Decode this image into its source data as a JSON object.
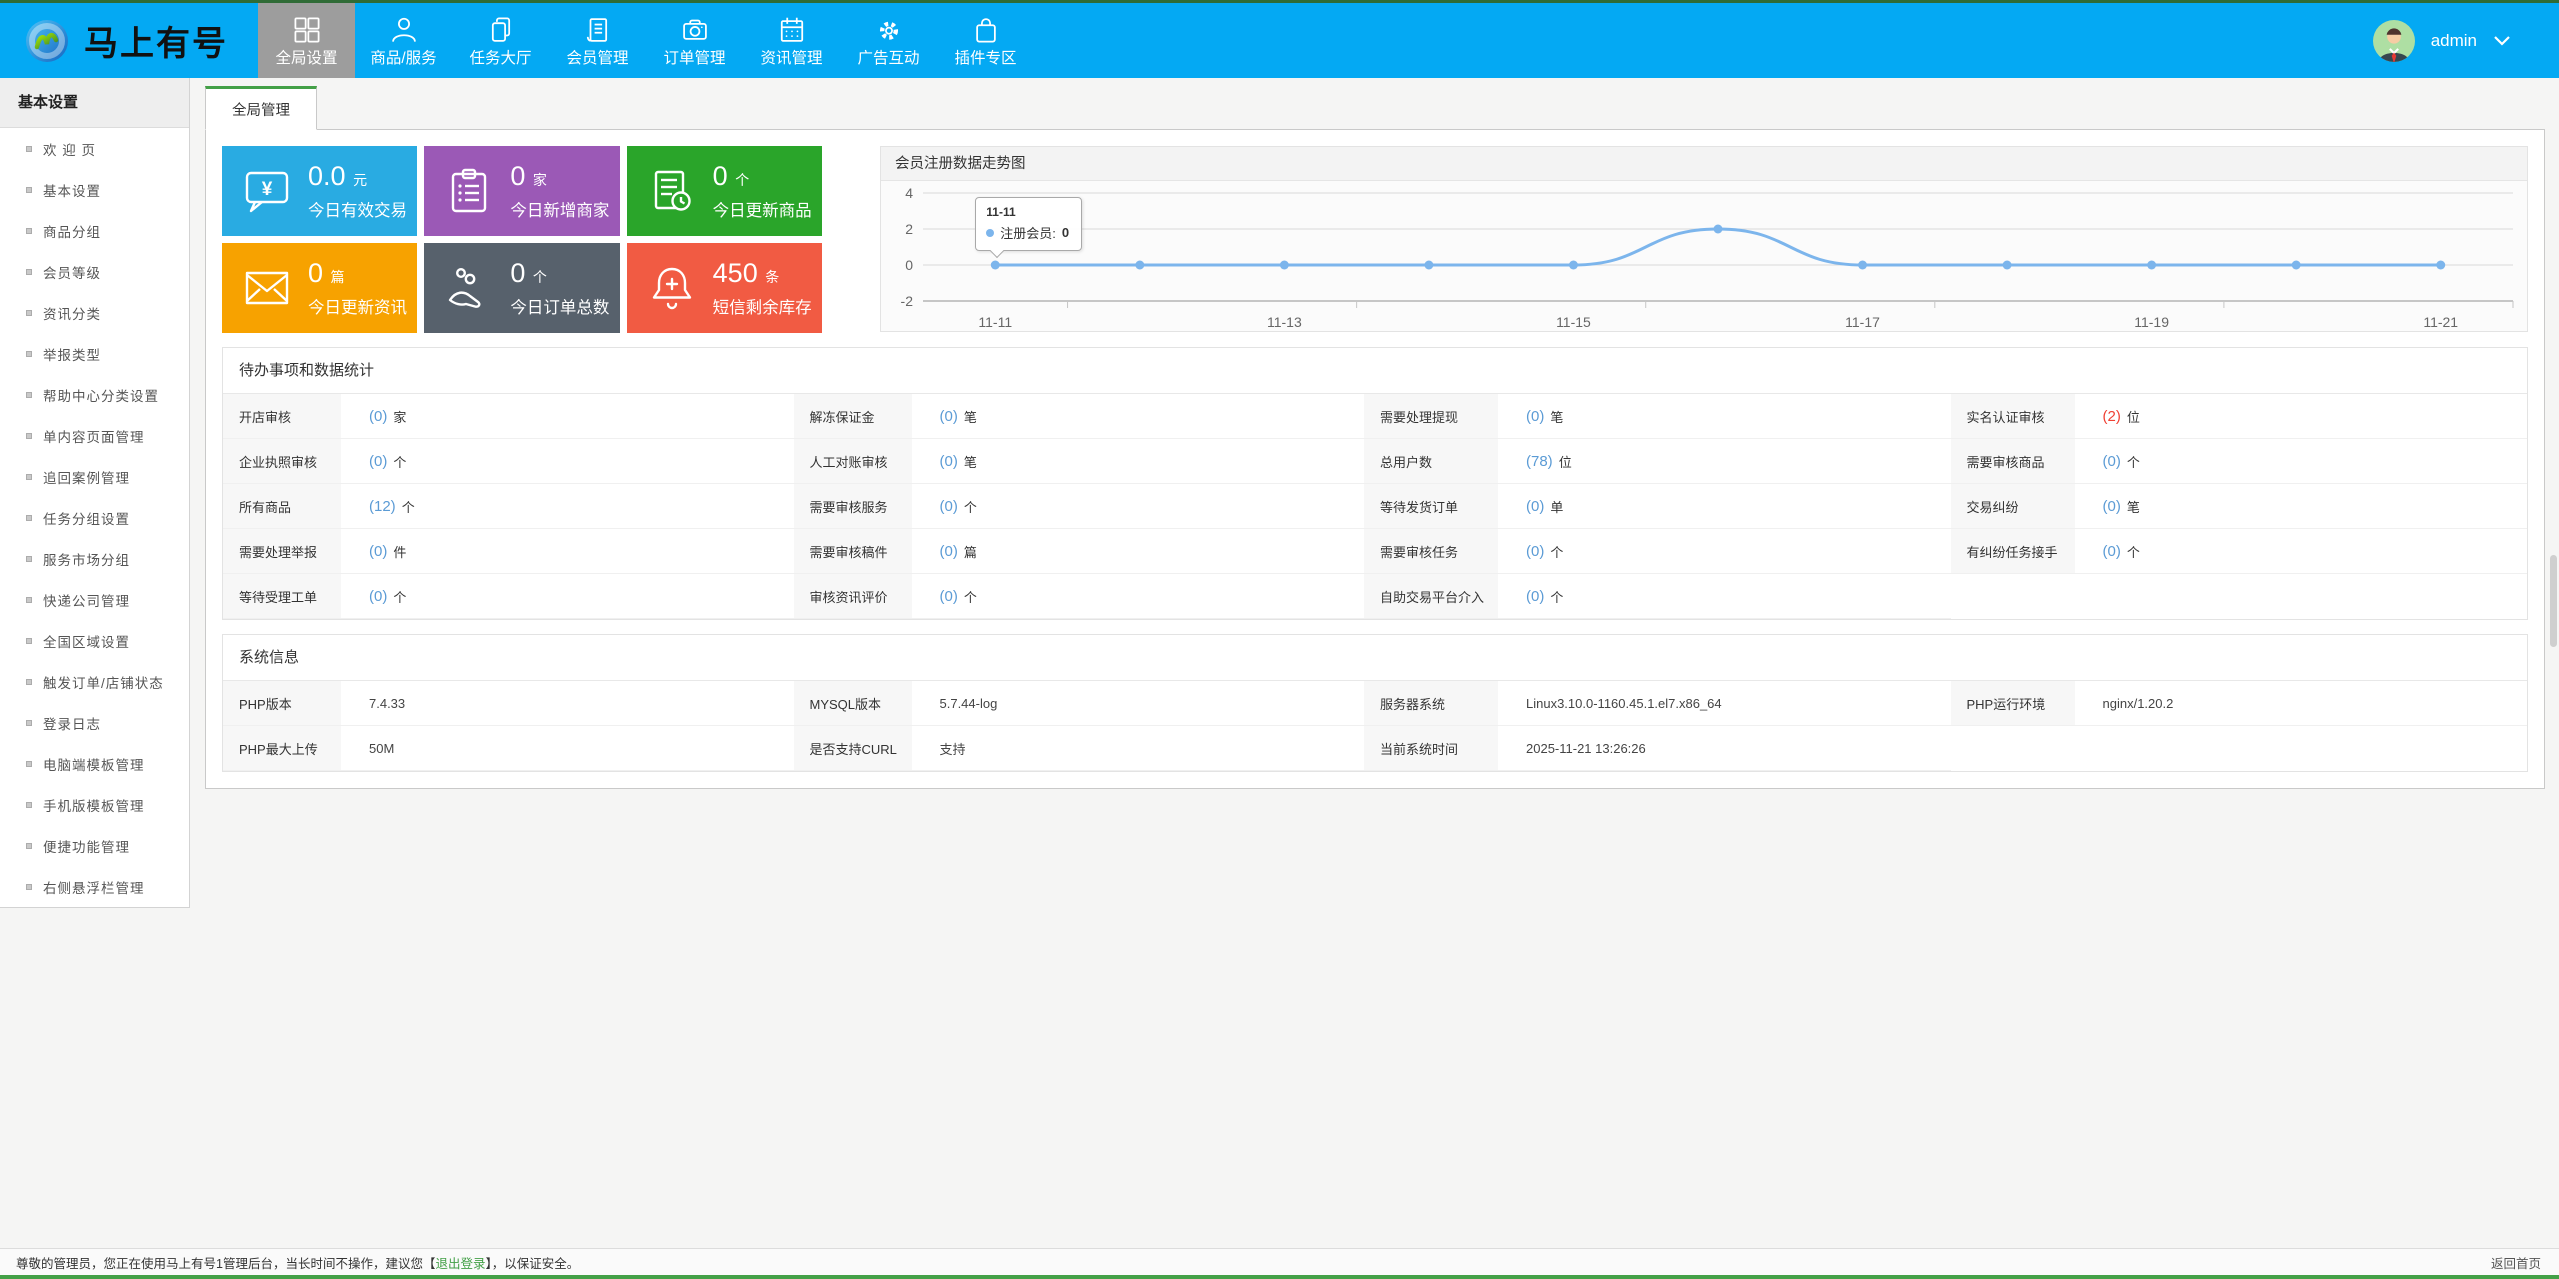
{
  "navbar": {
    "logo_text": "马上有号",
    "items": [
      {
        "label": "全局设置",
        "icon": "grid-icon",
        "active": true
      },
      {
        "label": "商品/服务",
        "icon": "user-icon",
        "active": false
      },
      {
        "label": "任务大厅",
        "icon": "copy-icon",
        "active": false
      },
      {
        "label": "会员管理",
        "icon": "document-list-icon",
        "active": false
      },
      {
        "label": "订单管理",
        "icon": "camera-icon",
        "active": false
      },
      {
        "label": "资讯管理",
        "icon": "calendar-icon",
        "active": false
      },
      {
        "label": "广告互动",
        "icon": "gear-icon",
        "active": false
      },
      {
        "label": "插件专区",
        "icon": "bag-icon",
        "active": false
      }
    ],
    "user": {
      "name": "admin"
    },
    "colors": {
      "background": "#04A9F3",
      "active_item": "#9D9D9D",
      "top_strip": "#2F6B36"
    }
  },
  "sidebar": {
    "title": "基本设置",
    "items": [
      "欢 迎 页",
      "基本设置",
      "商品分组",
      "会员等级",
      "资讯分类",
      "举报类型",
      "帮助中心分类设置",
      "单内容页面管理",
      "追回案例管理",
      "任务分组设置",
      "服务市场分组",
      "快递公司管理",
      "全国区域设置",
      "触发订单/店铺状态",
      "登录日志",
      "电脑端模板管理",
      "手机版模板管理",
      "便捷功能管理",
      "右侧悬浮栏管理"
    ]
  },
  "tabs": {
    "active_label": "全局管理",
    "accent_color": "#43A047"
  },
  "stat_cards": [
    {
      "value": "0.0",
      "unit": "元",
      "label": "今日有效交易",
      "color": "#29ABE2",
      "icon": "chat-yuan-icon"
    },
    {
      "value": "0",
      "unit": "家",
      "label": "今日新增商家",
      "color": "#9B59B6",
      "icon": "clipboard-icon"
    },
    {
      "value": "0",
      "unit": "个",
      "label": "今日更新商品",
      "color": "#2AA52A",
      "icon": "document-clock-icon"
    },
    {
      "value": "0",
      "unit": "篇",
      "label": "今日更新资讯",
      "color": "#F7A200",
      "icon": "envelope-icon"
    },
    {
      "value": "0",
      "unit": "个",
      "label": "今日订单总数",
      "color": "#57616C",
      "icon": "hand-coins-icon"
    },
    {
      "value": "450",
      "unit": "条",
      "label": "短信剩余库存",
      "color": "#F15B43",
      "icon": "bell-plus-icon"
    }
  ],
  "chart": {
    "title": "会员注册数据走势图",
    "tooltip": {
      "date": "11-11",
      "series_label": "注册会员:",
      "value": "0"
    },
    "chart_data": {
      "type": "line",
      "x": [
        "11-11",
        "11-12",
        "11-13",
        "11-14",
        "11-15",
        "11-16",
        "11-17",
        "11-18",
        "11-19",
        "11-20",
        "11-21"
      ],
      "series": [
        {
          "name": "注册会员",
          "values": [
            0,
            0,
            0,
            0,
            0,
            2,
            0,
            0,
            0,
            0,
            0
          ]
        }
      ],
      "title": "会员注册数据走势图",
      "xlabel": "",
      "ylabel": "",
      "yticks": [
        4,
        2,
        0,
        -2
      ],
      "ylim": [
        -2,
        4
      ],
      "x_tick_labels_shown": [
        "11-11",
        "11-13",
        "11-15",
        "11-17",
        "11-19",
        "11-21"
      ],
      "grid": true,
      "legend": "hidden",
      "line_color": "#7CB5EC"
    }
  },
  "todo": {
    "title": "待办事项和数据统计",
    "value_color": "#5B9BD5",
    "alert_color": "#F04134",
    "cells": [
      {
        "label": "开店审核",
        "value": "(0)",
        "unit": "家"
      },
      {
        "label": "解冻保证金",
        "value": "(0)",
        "unit": "笔"
      },
      {
        "label": "需要处理提现",
        "value": "(0)",
        "unit": "笔"
      },
      {
        "label": "实名认证审核",
        "value": "(2)",
        "unit": "位",
        "alert": true
      },
      {
        "label": "企业执照审核",
        "value": "(0)",
        "unit": "个"
      },
      {
        "label": "人工对账审核",
        "value": "(0)",
        "unit": "笔"
      },
      {
        "label": "总用户数",
        "value": "(78)",
        "unit": "位"
      },
      {
        "label": "需要审核商品",
        "value": "(0)",
        "unit": "个"
      },
      {
        "label": "所有商品",
        "value": "(12)",
        "unit": "个"
      },
      {
        "label": "需要审核服务",
        "value": "(0)",
        "unit": "个"
      },
      {
        "label": "等待发货订单",
        "value": "(0)",
        "unit": "单"
      },
      {
        "label": "交易纠纷",
        "value": "(0)",
        "unit": "笔"
      },
      {
        "label": "需要处理举报",
        "value": "(0)",
        "unit": "件"
      },
      {
        "label": "需要审核稿件",
        "value": "(0)",
        "unit": "篇"
      },
      {
        "label": "需要审核任务",
        "value": "(0)",
        "unit": "个"
      },
      {
        "label": "有纠纷任务接手",
        "value": "(0)",
        "unit": "个"
      },
      {
        "label": "等待受理工单",
        "value": "(0)",
        "unit": "个"
      },
      {
        "label": "审核资讯评价",
        "value": "(0)",
        "unit": "个"
      },
      {
        "label": "自助交易平台介入",
        "value": "(0)",
        "unit": "个"
      },
      {
        "label": "",
        "value": "",
        "unit": ""
      }
    ]
  },
  "system": {
    "title": "系统信息",
    "cells": [
      {
        "label": "PHP版本",
        "value": "7.4.33"
      },
      {
        "label": "MYSQL版本",
        "value": "5.7.44-log"
      },
      {
        "label": "服务器系统",
        "value": "Linux3.10.0-1160.45.1.el7.x86_64"
      },
      {
        "label": "PHP运行环境",
        "value": "nginx/1.20.2"
      },
      {
        "label": "PHP最大上传",
        "value": "50M"
      },
      {
        "label": "是否支持CURL",
        "value": "支持"
      },
      {
        "label": "当前系统时间",
        "value": "2025-11-21 13:26:26"
      },
      {
        "label": "",
        "value": ""
      }
    ]
  },
  "footer": {
    "text_pre": "尊敬的管理员，您正在使用马上有号1管理后台，当长时间不操作，建议您【",
    "logout_label": "退出登录",
    "text_post": "】，以保证安全。",
    "home_label": "返回首页",
    "link_color": "#43A047"
  }
}
